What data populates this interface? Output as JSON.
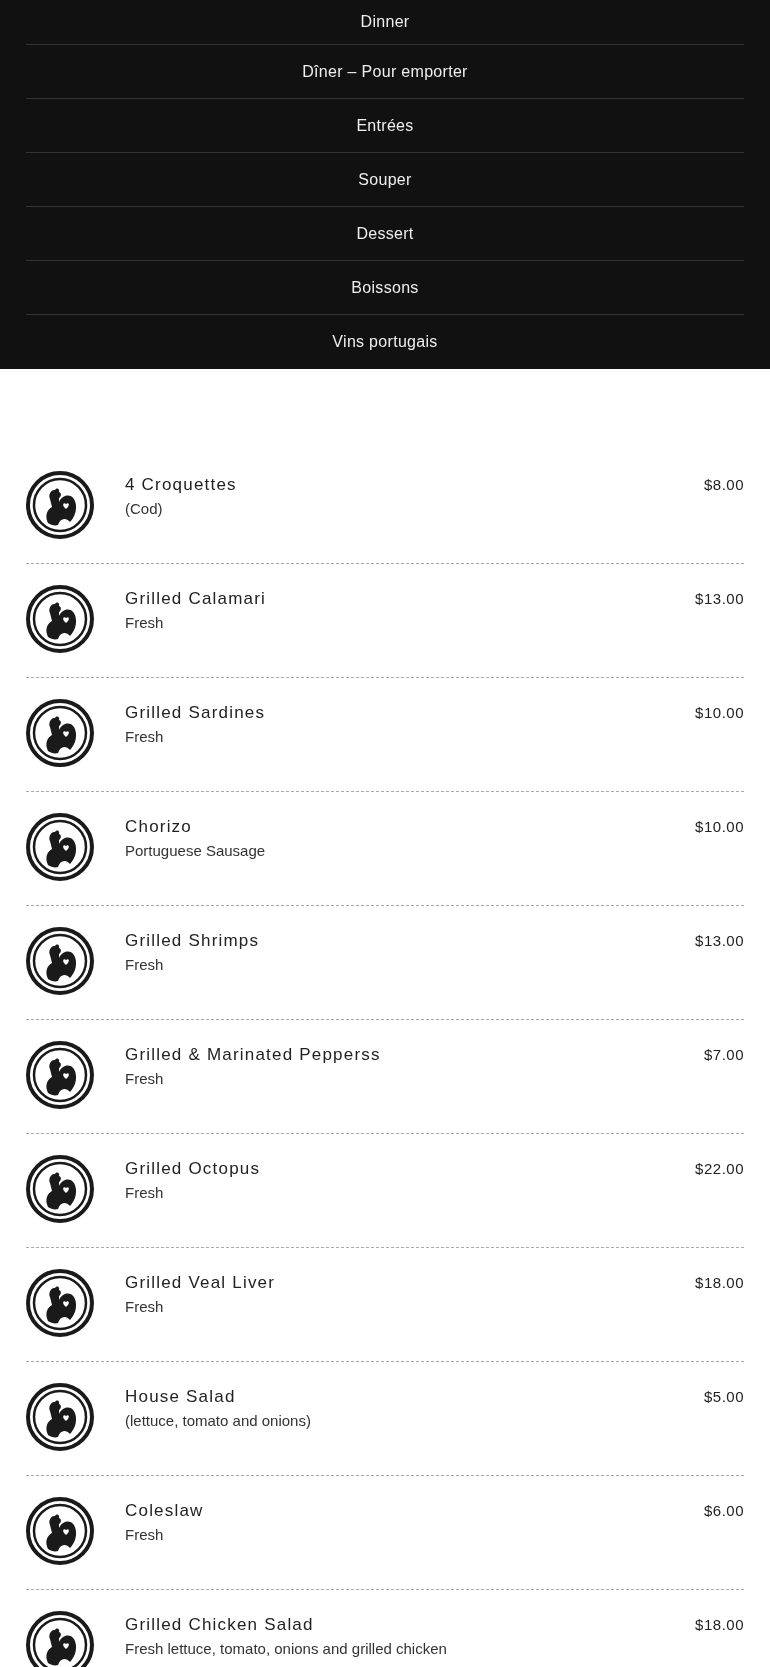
{
  "nav": [
    {
      "label": "Dinner"
    },
    {
      "label": "Dîner – Pour emporter"
    },
    {
      "label": "Entrées"
    },
    {
      "label": "Souper"
    },
    {
      "label": "Dessert"
    },
    {
      "label": "Boissons"
    },
    {
      "label": "Vins portugais"
    }
  ],
  "items": [
    {
      "name": "4 Croquettes",
      "description": "(Cod)",
      "price": "$8.00"
    },
    {
      "name": "Grilled Calamari",
      "description": "Fresh",
      "price": "$13.00"
    },
    {
      "name": "Grilled Sardines",
      "description": "Fresh",
      "price": "$10.00"
    },
    {
      "name": "Chorizo",
      "description": "Portuguese Sausage",
      "price": "$10.00"
    },
    {
      "name": "Grilled Shrimps",
      "description": "Fresh",
      "price": "$13.00"
    },
    {
      "name": "Grilled & Marinated Pepperss",
      "description": "Fresh",
      "price": "$7.00"
    },
    {
      "name": "Grilled Octopus",
      "description": "Fresh",
      "price": "$22.00"
    },
    {
      "name": "Grilled Veal Liver",
      "description": "Fresh",
      "price": "$18.00"
    },
    {
      "name": "House Salad",
      "description": "(lettuce, tomato and onions)",
      "price": "$5.00"
    },
    {
      "name": "Coleslaw",
      "description": "Fresh",
      "price": "$6.00"
    },
    {
      "name": "Grilled Chicken Salad",
      "description": "Fresh lettuce, tomato, onions and grilled chicken",
      "price": "$18.00"
    }
  ]
}
